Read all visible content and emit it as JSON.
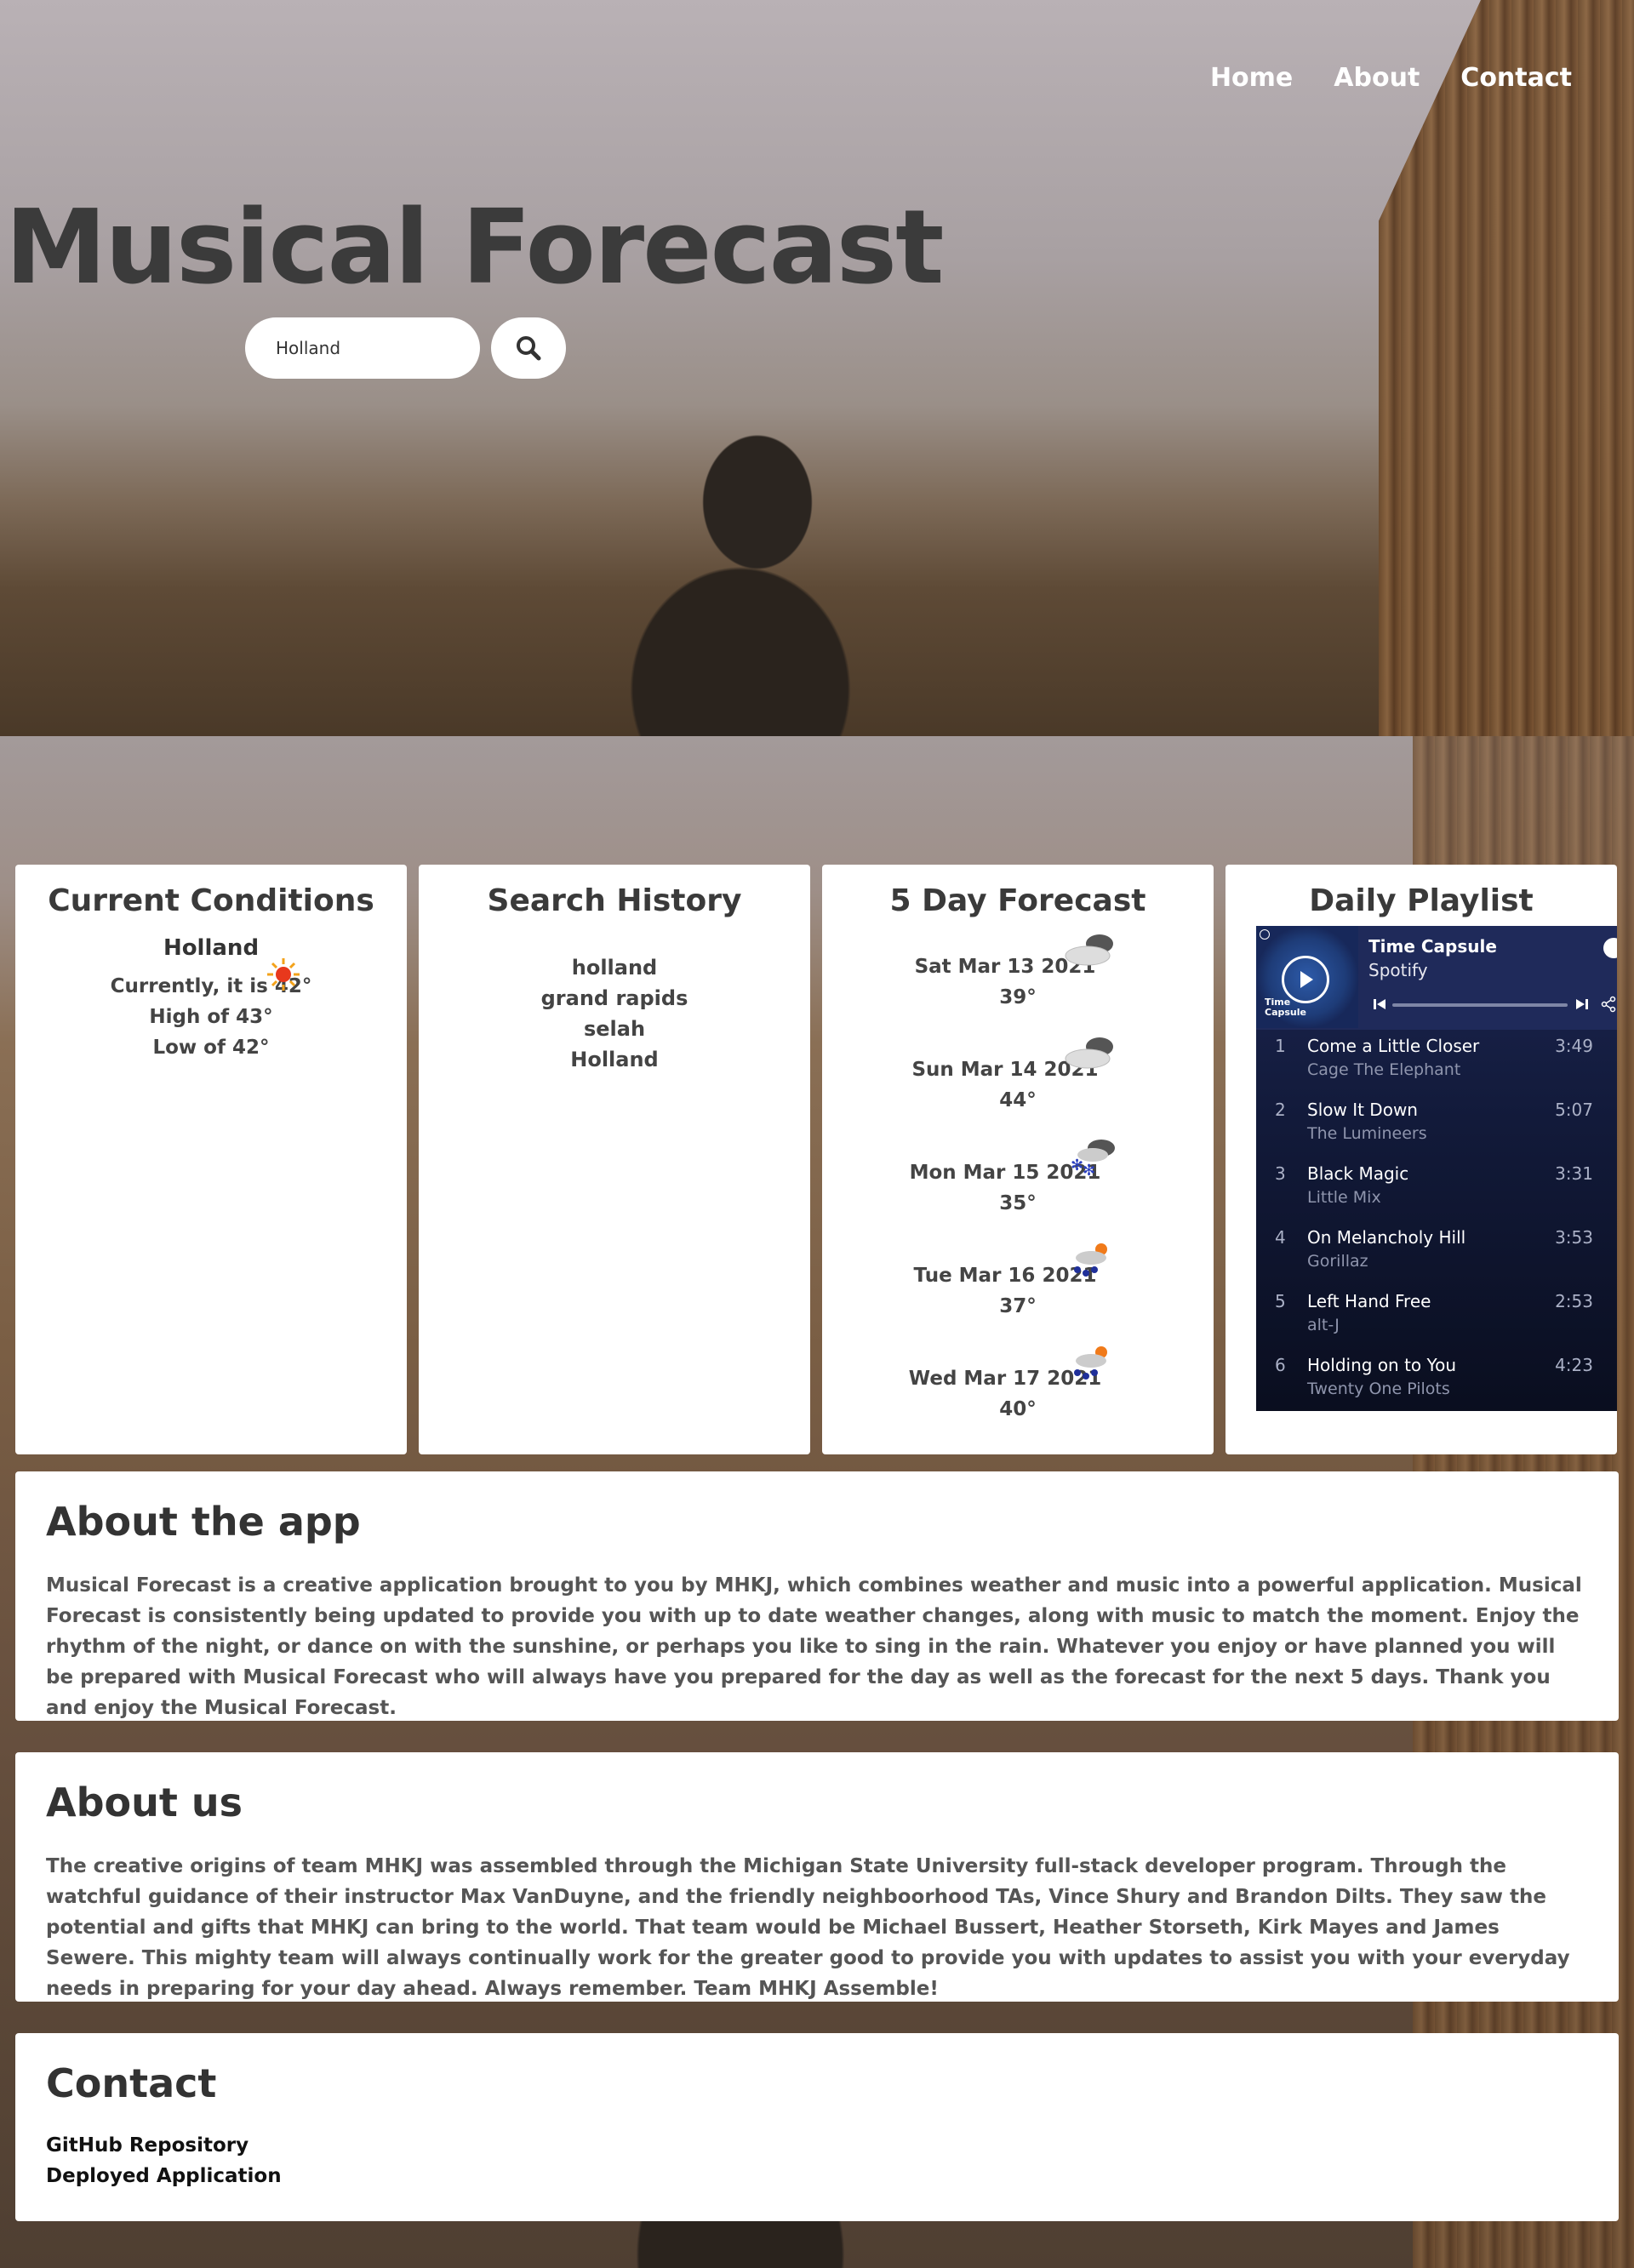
{
  "nav": {
    "home": "Home",
    "about": "About",
    "contact": "Contact"
  },
  "hero": {
    "title": "Musical Forecast"
  },
  "search": {
    "value": "Holland"
  },
  "current": {
    "title": "Current Conditions",
    "city": "Holland",
    "icon": "sun-icon",
    "currently": "Currently, it is 42°",
    "high": "High of 43°",
    "low": "Low of 42°"
  },
  "history": {
    "title": "Search History",
    "items": [
      "holland",
      "grand rapids",
      "selah",
      "Holland"
    ]
  },
  "forecast": {
    "title": "5 Day Forecast",
    "days": [
      {
        "date": "Sat Mar 13 2021",
        "temp": "39°",
        "icon": "cloudy-icon"
      },
      {
        "date": "Sun Mar 14 2021",
        "temp": "44°",
        "icon": "cloudy-icon"
      },
      {
        "date": "Mon Mar 15 2021",
        "temp": "35°",
        "icon": "snow-icon"
      },
      {
        "date": "Tue Mar 16 2021",
        "temp": "37°",
        "icon": "rain-sun-icon"
      },
      {
        "date": "Wed Mar 17 2021",
        "temp": "40°",
        "icon": "rain-sun-icon"
      }
    ]
  },
  "playlist": {
    "title": "Daily Playlist",
    "name": "Time Capsule",
    "source": "Spotify",
    "cover_label": "Time Capsule",
    "tracks": [
      {
        "num": "1",
        "name": "Come a Little Closer",
        "artist": "Cage The Elephant",
        "duration": "3:49"
      },
      {
        "num": "2",
        "name": "Slow It Down",
        "artist": "The Lumineers",
        "duration": "5:07"
      },
      {
        "num": "3",
        "name": "Black Magic",
        "artist": "Little Mix",
        "duration": "3:31"
      },
      {
        "num": "4",
        "name": "On Melancholy Hill",
        "artist": "Gorillaz",
        "duration": "3:53"
      },
      {
        "num": "5",
        "name": "Left Hand Free",
        "artist": "alt-J",
        "duration": "2:53"
      },
      {
        "num": "6",
        "name": "Holding on to You",
        "artist": "Twenty One Pilots",
        "duration": "4:23"
      }
    ]
  },
  "about_app": {
    "title": "About the app",
    "body": "Musical Forecast is a creative application brought to you by MHKJ, which combines weather and music into a powerful application. Musical Forecast is consistently being updated to provide you with up to date weather changes, along with music to match the moment. Enjoy the rhythm of the night, or dance on with the sunshine, or perhaps you like to sing in the rain. Whatever you enjoy or have planned you will be prepared with Musical Forecast who will always have you prepared for the day as well as the forecast for the next 5 days. Thank you and enjoy the Musical Forecast."
  },
  "about_us": {
    "title": "About us",
    "body": "The creative origins of team MHKJ was assembled through the Michigan State University full-stack developer program. Through the watchful guidance of their instructor Max VanDuyne, and the friendly neighboorhood TAs, Vince Shury and Brandon Dilts. They saw the potential and gifts that MHKJ can bring to the world. That team would be Michael Bussert, Heather Storseth, Kirk Mayes and James Sewere. This mighty team will always continually work for the greater good to provide you with updates to assist you with your everyday needs in preparing for your day ahead. Always remember. Team MHKJ Assemble!"
  },
  "contact": {
    "title": "Contact",
    "github": "GitHub Repository",
    "deployed": "Deployed Application"
  },
  "colors": {
    "card_bg": "#ffffff",
    "title_text": "#3b3b3b",
    "spotify_bg": "#1b2550"
  }
}
